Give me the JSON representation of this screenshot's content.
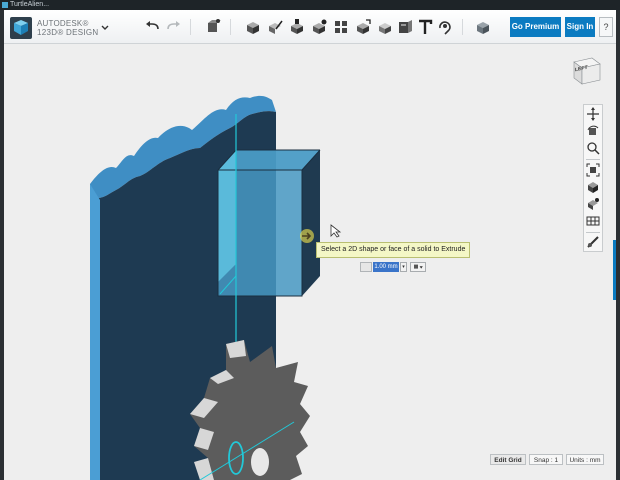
{
  "window": {
    "title": "TurtleAlien..."
  },
  "brand": {
    "line1": "AUTODESK®",
    "line2": "123D® DESIGN"
  },
  "toolbar": {
    "tools": [
      {
        "name": "undo-icon"
      },
      {
        "name": "redo-icon"
      },
      {
        "name": "transform-icon"
      },
      {
        "name": "primitives-icon"
      },
      {
        "name": "sketch-icon"
      },
      {
        "name": "construct-icon"
      },
      {
        "name": "modify-icon"
      },
      {
        "name": "pattern-icon"
      },
      {
        "name": "grouping-icon"
      },
      {
        "name": "combine-icon"
      },
      {
        "name": "measure-icon"
      },
      {
        "name": "text-icon"
      },
      {
        "name": "snap-icon"
      },
      {
        "name": "material-icon"
      }
    ]
  },
  "account": {
    "premium_label": "Go Premium",
    "signin_label": "Sign In",
    "help_label": "?"
  },
  "viewcube": {
    "face_label": "LEFT"
  },
  "tooltip": {
    "text": "Select a 2D shape or face of a solid to Extrude"
  },
  "dimension": {
    "value": "1.00 mm",
    "spin": "▾"
  },
  "status": {
    "grid_label": "Edit Grid",
    "snap_label": "Snap : 1",
    "units_label": "Units : mm"
  },
  "colors": {
    "accent": "#0b7bc1",
    "body_blue": "#3b7fae",
    "body_dark": "#1d3448",
    "selected_cyan": "#3fb6d6",
    "gear_gray": "#5f5f5f"
  }
}
